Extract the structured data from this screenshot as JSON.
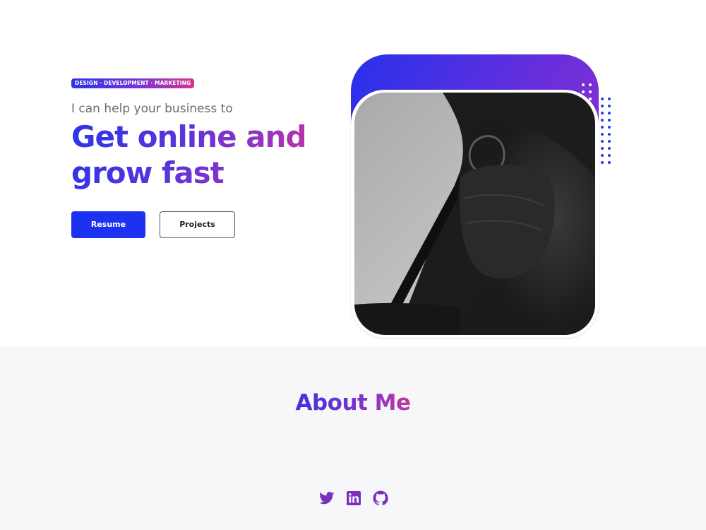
{
  "hero": {
    "tagline": "DESIGN · DEVELOPMENT · MARKETING",
    "intro": "I can help your business to",
    "headline_line1": "Get online and",
    "headline_line2": "grow fast",
    "buttons": {
      "primary_label": "Resume",
      "secondary_label": "Projects"
    },
    "photo_icon": "portrait-photo"
  },
  "about": {
    "title": "About Me",
    "socials": [
      {
        "icon": "twitter-icon"
      },
      {
        "icon": "linkedin-icon"
      },
      {
        "icon": "github-icon"
      }
    ]
  },
  "colors": {
    "accent_blue": "#1d31f1",
    "accent_purple": "#7b33cf",
    "accent_pink": "#d4368f",
    "social_icon": "#7b2fbf",
    "about_background": "#f7f7f9"
  }
}
